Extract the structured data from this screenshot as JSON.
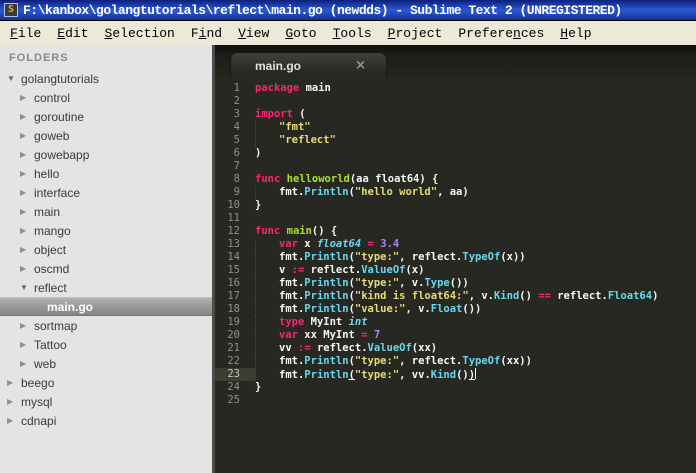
{
  "window": {
    "title": "F:\\kanbox\\golangtutorials\\reflect\\main.go (newdds) - Sublime Text 2 (UNREGISTERED)",
    "icon_glyph": "S"
  },
  "menu": {
    "items": [
      {
        "label": "File",
        "u": 0
      },
      {
        "label": "Edit",
        "u": 0
      },
      {
        "label": "Selection",
        "u": 0
      },
      {
        "label": "Find",
        "u": 1
      },
      {
        "label": "View",
        "u": 0
      },
      {
        "label": "Goto",
        "u": 0
      },
      {
        "label": "Tools",
        "u": 0
      },
      {
        "label": "Project",
        "u": 0
      },
      {
        "label": "Preferences",
        "u": 7
      },
      {
        "label": "Help",
        "u": 0
      }
    ]
  },
  "sidebar": {
    "header": "FOLDERS",
    "items": [
      {
        "label": "golangtutorials",
        "level": 0,
        "state": "expanded",
        "selected": false
      },
      {
        "label": "control",
        "level": 1,
        "state": "collapsed",
        "selected": false
      },
      {
        "label": "goroutine",
        "level": 1,
        "state": "collapsed",
        "selected": false
      },
      {
        "label": "goweb",
        "level": 1,
        "state": "collapsed",
        "selected": false
      },
      {
        "label": "gowebapp",
        "level": 1,
        "state": "collapsed",
        "selected": false
      },
      {
        "label": "hello",
        "level": 1,
        "state": "collapsed",
        "selected": false
      },
      {
        "label": "interface",
        "level": 1,
        "state": "collapsed",
        "selected": false
      },
      {
        "label": "main",
        "level": 1,
        "state": "collapsed",
        "selected": false
      },
      {
        "label": "mango",
        "level": 1,
        "state": "collapsed",
        "selected": false
      },
      {
        "label": "object",
        "level": 1,
        "state": "collapsed",
        "selected": false
      },
      {
        "label": "oscmd",
        "level": 1,
        "state": "collapsed",
        "selected": false
      },
      {
        "label": "reflect",
        "level": 1,
        "state": "expanded",
        "selected": false
      },
      {
        "label": "main.go",
        "level": 2,
        "state": "file",
        "selected": true
      },
      {
        "label": "sortmap",
        "level": 1,
        "state": "collapsed",
        "selected": false
      },
      {
        "label": "Tattoo",
        "level": 1,
        "state": "collapsed",
        "selected": false
      },
      {
        "label": "web",
        "level": 1,
        "state": "collapsed",
        "selected": false
      },
      {
        "label": "beego",
        "level": 0,
        "state": "collapsed",
        "selected": false
      },
      {
        "label": "mysql",
        "level": 0,
        "state": "collapsed",
        "selected": false
      },
      {
        "label": "cdnapi",
        "level": 0,
        "state": "collapsed",
        "selected": false
      }
    ]
  },
  "tabs": [
    {
      "label": "main.go",
      "close_glyph": "×",
      "active": true
    }
  ],
  "editor": {
    "language": "Go",
    "active_line": 23,
    "caret_line": 23,
    "colors": {
      "background": "#272822",
      "foreground": "#F8F8F2",
      "keyword": "#F92672",
      "function": "#A6E22E",
      "call": "#66D9EF",
      "type": "#66D9EF",
      "string": "#E6DB74",
      "number": "#AE81FF",
      "line_number": "#90908A",
      "active_gutter": "#3E3D32",
      "sidebar_bg": "#E4E4E4",
      "titlebar_blue": "#2753CD",
      "menubar_bg": "#ECE9D8"
    },
    "lines": [
      {
        "num": 1,
        "indent": 0,
        "tokens": [
          [
            "k",
            "package"
          ],
          [
            "p",
            " main"
          ]
        ]
      },
      {
        "num": 2,
        "indent": 0,
        "tokens": []
      },
      {
        "num": 3,
        "indent": 0,
        "tokens": [
          [
            "k",
            "import"
          ],
          [
            "p",
            " ("
          ]
        ]
      },
      {
        "num": 4,
        "indent": 1,
        "tokens": [
          [
            "s",
            "\"fmt\""
          ]
        ]
      },
      {
        "num": 5,
        "indent": 1,
        "tokens": [
          [
            "s",
            "\"reflect\""
          ]
        ]
      },
      {
        "num": 6,
        "indent": 0,
        "tokens": [
          [
            "p",
            ")"
          ]
        ]
      },
      {
        "num": 7,
        "indent": 0,
        "tokens": []
      },
      {
        "num": 8,
        "indent": 0,
        "tokens": [
          [
            "k",
            "func"
          ],
          [
            "p",
            " "
          ],
          [
            "f",
            "helloworld"
          ],
          [
            "p",
            "(aa float64) {"
          ]
        ]
      },
      {
        "num": 9,
        "indent": 1,
        "tokens": [
          [
            "p",
            "fmt."
          ],
          [
            "c",
            "Println"
          ],
          [
            "p",
            "("
          ],
          [
            "s",
            "\"hello world\""
          ],
          [
            "p",
            ", aa)"
          ]
        ]
      },
      {
        "num": 10,
        "indent": 0,
        "tokens": [
          [
            "p",
            "}"
          ]
        ]
      },
      {
        "num": 11,
        "indent": 0,
        "tokens": []
      },
      {
        "num": 12,
        "indent": 0,
        "tokens": [
          [
            "k",
            "func"
          ],
          [
            "p",
            " "
          ],
          [
            "f",
            "main"
          ],
          [
            "p",
            "() {"
          ]
        ]
      },
      {
        "num": 13,
        "indent": 1,
        "tokens": [
          [
            "k",
            "var"
          ],
          [
            "p",
            " x "
          ],
          [
            "t",
            "float64"
          ],
          [
            "p",
            " "
          ],
          [
            "o",
            "="
          ],
          [
            "p",
            " "
          ],
          [
            "n",
            "3.4"
          ]
        ]
      },
      {
        "num": 14,
        "indent": 1,
        "tokens": [
          [
            "p",
            "fmt."
          ],
          [
            "c",
            "Println"
          ],
          [
            "p",
            "("
          ],
          [
            "s",
            "\"type:\""
          ],
          [
            "p",
            ", reflect."
          ],
          [
            "c",
            "TypeOf"
          ],
          [
            "p",
            "(x))"
          ]
        ]
      },
      {
        "num": 15,
        "indent": 1,
        "tokens": [
          [
            "p",
            "v "
          ],
          [
            "o",
            ":="
          ],
          [
            "p",
            " reflect."
          ],
          [
            "c",
            "ValueOf"
          ],
          [
            "p",
            "(x)"
          ]
        ]
      },
      {
        "num": 16,
        "indent": 1,
        "tokens": [
          [
            "p",
            "fmt."
          ],
          [
            "c",
            "Println"
          ],
          [
            "p",
            "("
          ],
          [
            "s",
            "\"type:\""
          ],
          [
            "p",
            ", v."
          ],
          [
            "c",
            "Type"
          ],
          [
            "p",
            "())"
          ]
        ]
      },
      {
        "num": 17,
        "indent": 1,
        "tokens": [
          [
            "p",
            "fmt."
          ],
          [
            "c",
            "Println"
          ],
          [
            "p",
            "("
          ],
          [
            "s",
            "\"kind is float64:\""
          ],
          [
            "p",
            ", v."
          ],
          [
            "c",
            "Kind"
          ],
          [
            "p",
            "() "
          ],
          [
            "o",
            "=="
          ],
          [
            "p",
            " reflect."
          ],
          [
            "c",
            "Float64"
          ],
          [
            "p",
            ")"
          ]
        ]
      },
      {
        "num": 18,
        "indent": 1,
        "tokens": [
          [
            "p",
            "fmt."
          ],
          [
            "c",
            "Println"
          ],
          [
            "p",
            "("
          ],
          [
            "s",
            "\"value:\""
          ],
          [
            "p",
            ", v."
          ],
          [
            "c",
            "Float"
          ],
          [
            "p",
            "())"
          ]
        ]
      },
      {
        "num": 19,
        "indent": 1,
        "tokens": [
          [
            "k",
            "type"
          ],
          [
            "p",
            " MyInt "
          ],
          [
            "t",
            "int"
          ]
        ]
      },
      {
        "num": 20,
        "indent": 1,
        "tokens": [
          [
            "k",
            "var"
          ],
          [
            "p",
            " xx MyInt "
          ],
          [
            "o",
            "="
          ],
          [
            "p",
            " "
          ],
          [
            "n",
            "7"
          ]
        ]
      },
      {
        "num": 21,
        "indent": 1,
        "tokens": [
          [
            "p",
            "vv "
          ],
          [
            "o",
            ":="
          ],
          [
            "p",
            " reflect."
          ],
          [
            "c",
            "ValueOf"
          ],
          [
            "p",
            "(xx)"
          ]
        ]
      },
      {
        "num": 22,
        "indent": 1,
        "tokens": [
          [
            "p",
            "fmt."
          ],
          [
            "c",
            "Println"
          ],
          [
            "p",
            "("
          ],
          [
            "s",
            "\"type:\""
          ],
          [
            "p",
            ", reflect."
          ],
          [
            "c",
            "TypeOf"
          ],
          [
            "p",
            "(xx))"
          ]
        ]
      },
      {
        "num": 23,
        "indent": 1,
        "tokens": [
          [
            "p",
            "fmt."
          ],
          [
            "c",
            "Println"
          ],
          [
            "u",
            "("
          ],
          [
            "s",
            "\"type:\""
          ],
          [
            "p",
            ", vv."
          ],
          [
            "c",
            "Kind"
          ],
          [
            "p",
            "()"
          ],
          [
            "u",
            ")"
          ]
        ]
      },
      {
        "num": 24,
        "indent": 0,
        "tokens": [
          [
            "p",
            "}"
          ]
        ]
      },
      {
        "num": 25,
        "indent": 0,
        "tokens": []
      }
    ]
  }
}
